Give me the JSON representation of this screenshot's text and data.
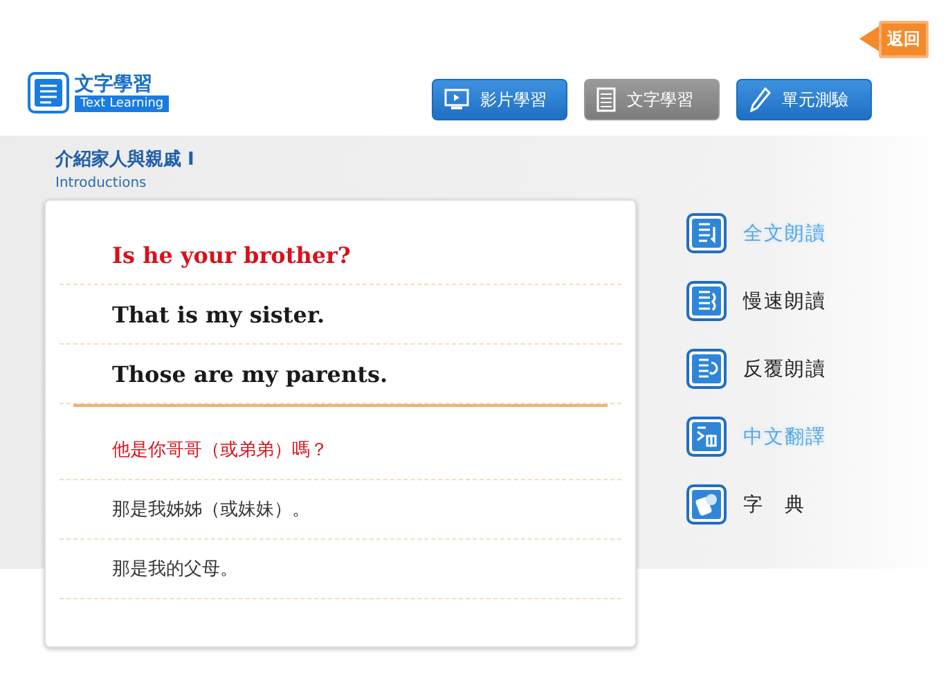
{
  "back_button": {
    "label": "返回"
  },
  "logo": {
    "title": "文字學習",
    "subtitle": "Text Learning"
  },
  "nav": [
    {
      "label": "影片學習",
      "kind": "video",
      "selected": false
    },
    {
      "label": "文字學習",
      "kind": "document",
      "selected": true
    },
    {
      "label": "單元測驗",
      "kind": "pencil",
      "selected": false
    }
  ],
  "lesson": {
    "title": "介紹家人與親戚",
    "marker": "I",
    "subtitle": "Introductions"
  },
  "english_sentences": [
    {
      "text": "Is he your brother?",
      "highlighted": true
    },
    {
      "text": "That is my sister.",
      "highlighted": false
    },
    {
      "text": "Those are my parents.",
      "highlighted": false
    }
  ],
  "chinese_sentences": [
    {
      "text": "他是你哥哥（或弟弟）嗎？",
      "highlighted": true
    },
    {
      "text": "那是我姊姊（或妹妹）。",
      "highlighted": false
    },
    {
      "text": "那是我的父母。",
      "highlighted": false
    }
  ],
  "tools": [
    {
      "label": "全文朗讀",
      "kind": "read-all",
      "active": true
    },
    {
      "label": "慢速朗讀",
      "kind": "read-slow",
      "active": false
    },
    {
      "label": "反覆朗讀",
      "kind": "repeat",
      "active": false
    },
    {
      "label": "中文翻譯",
      "kind": "translate",
      "active": true
    },
    {
      "label": "字　典",
      "kind": "dictionary",
      "active": false
    }
  ]
}
